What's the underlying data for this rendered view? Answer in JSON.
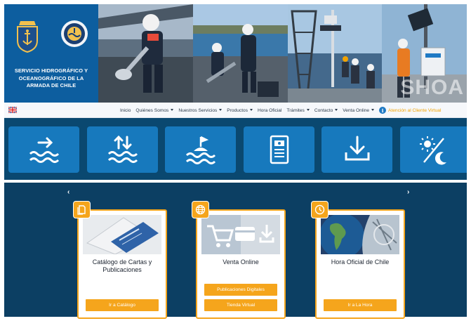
{
  "header": {
    "org_name": "SERVICIO HIDROGRÁFICO Y OCEANOGRÁFICO DE LA ARMADA DE CHILE",
    "watermark": "SHOA",
    "photos": [
      "technician-with-instrument",
      "technicians-at-pier",
      "tide-gauge-station",
      "technician-at-solar-mast"
    ]
  },
  "nav": {
    "language_flag": "flag-uk-icon",
    "items": [
      {
        "label": "Inicio",
        "dropdown": false
      },
      {
        "label": "Quiénes Somos",
        "dropdown": true
      },
      {
        "label": "Nuestros Servicios",
        "dropdown": true
      },
      {
        "label": "Productos",
        "dropdown": true
      },
      {
        "label": "Hora Oficial",
        "dropdown": false
      },
      {
        "label": "Trámites",
        "dropdown": true
      },
      {
        "label": "Contacto",
        "dropdown": true
      },
      {
        "label": "Venta Online",
        "dropdown": true
      }
    ],
    "citizen_link": "Atención al Cliente Virtual"
  },
  "tiles": [
    {
      "icon": "wave-arrow-right-icon"
    },
    {
      "icon": "wave-arrows-up-down-icon"
    },
    {
      "icon": "buoy-wave-icon"
    },
    {
      "icon": "document-icon"
    },
    {
      "icon": "download-icon"
    },
    {
      "icon": "sun-moon-icon"
    }
  ],
  "carousel": {
    "prev_label": "‹",
    "next_label": "›",
    "cards": [
      {
        "title": "Catálogo de Cartas y Publicaciones",
        "badge_icon": "document-copy-icon",
        "buttons": [
          "Ir a Catálogo"
        ]
      },
      {
        "title": "Venta Online",
        "badge_icon": "globe-icon",
        "buttons": [
          "Publicaciones Digitales",
          "Tienda Virtual"
        ]
      },
      {
        "title": "Hora Oficial de Chile",
        "badge_icon": "clock-icon",
        "buttons": [
          "Ir a La Hora"
        ]
      }
    ]
  },
  "colors": {
    "brand_blue": "#0d5e9f",
    "tile_blue": "#1779bd",
    "tile_band": "#0a4870",
    "carousel_bg": "#0c3f63",
    "accent_orange": "#f5a51c"
  }
}
